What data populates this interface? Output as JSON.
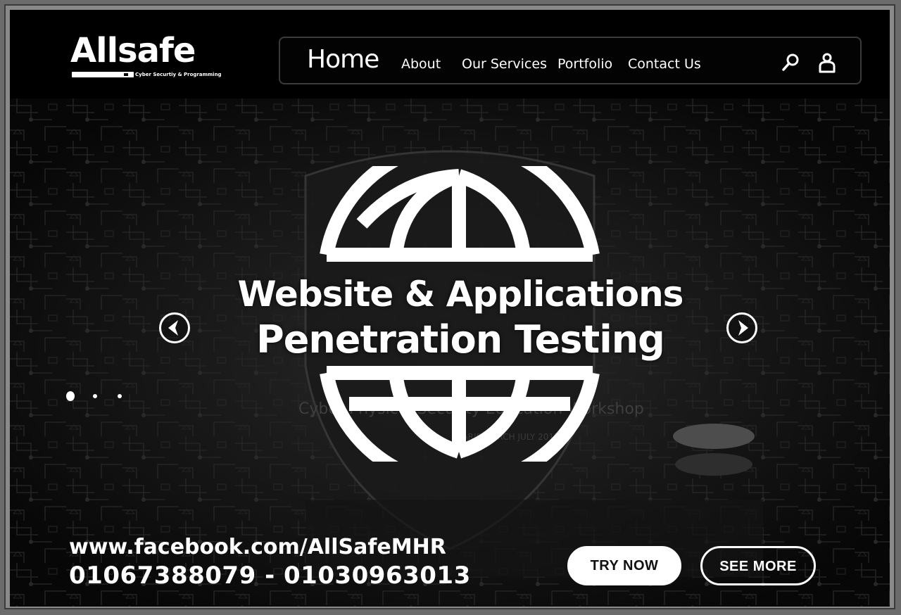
{
  "brand": {
    "name": "Allsafe",
    "tagline": "Cyber Securtiy & Programming"
  },
  "nav": {
    "items": [
      {
        "label": "Home",
        "active": true
      },
      {
        "label": "About"
      },
      {
        "label": "Our Services"
      },
      {
        "label": "Portfolio"
      },
      {
        "label": "Contact Us"
      }
    ],
    "icons": [
      "search-icon",
      "user-icon"
    ]
  },
  "hero": {
    "headline_line1": "Website & Applications",
    "headline_line2": "Penetration Testing",
    "background_text_1": "Cyber Physical Security Education Workshop",
    "background_text_2": "PARIS MARCH JULY 2017",
    "slider": {
      "current": 1,
      "total": 3
    },
    "arrows": [
      "chevron-left-icon",
      "chevron-right-icon"
    ]
  },
  "contact": {
    "facebook": "www.facebook.com/AllSafeMHR",
    "phones": "01067388079 - 01030963013"
  },
  "buttons": {
    "try_now": "TRY NOW",
    "see_more": "SEE MORE"
  },
  "colors": {
    "background": "#000000",
    "text": "#ffffff",
    "frame": "#8a8a8a"
  }
}
